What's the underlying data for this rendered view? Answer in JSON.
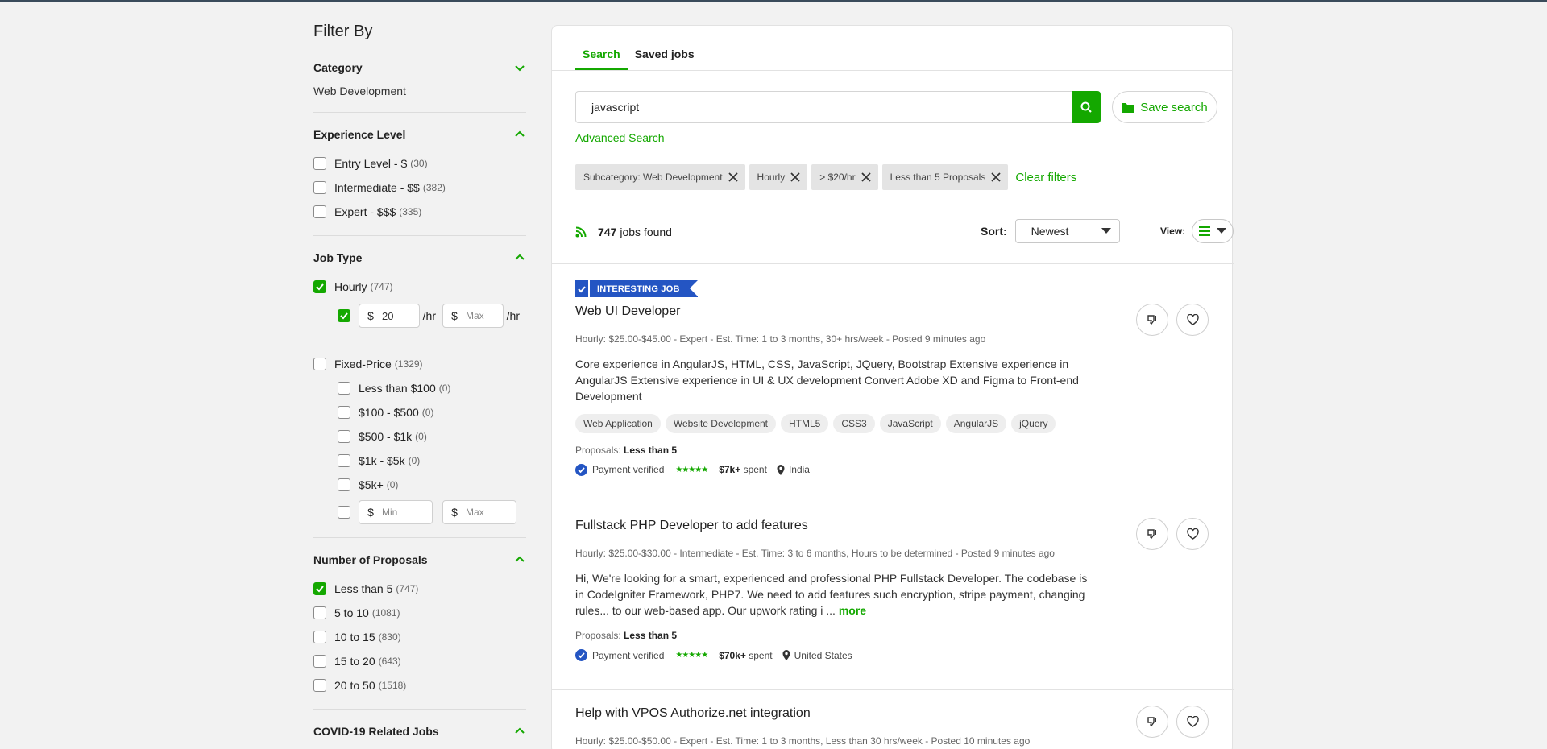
{
  "filters": {
    "title": "Filter By",
    "category": {
      "label": "Category",
      "value": "Web Development"
    },
    "experience": {
      "label": "Experience Level",
      "options": [
        {
          "label": "Entry Level - $",
          "count": "(30)",
          "checked": false
        },
        {
          "label": "Intermediate - $$",
          "count": "(382)",
          "checked": false
        },
        {
          "label": "Expert - $$$",
          "count": "(335)",
          "checked": false
        }
      ]
    },
    "job_type": {
      "label": "Job Type",
      "hourly": {
        "label": "Hourly",
        "count": "(747)",
        "checked": true
      },
      "rate": {
        "currency": "$",
        "min": "20",
        "max_placeholder": "Max",
        "unit": "/hr"
      },
      "fixed": {
        "label": "Fixed-Price",
        "count": "(1329)",
        "checked": false
      },
      "fixed_options": [
        {
          "label": "Less than $100",
          "count": "(0)"
        },
        {
          "label": "$100 - $500",
          "count": "(0)"
        },
        {
          "label": "$500 - $1k",
          "count": "(0)"
        },
        {
          "label": "$1k - $5k",
          "count": "(0)"
        },
        {
          "label": "$5k+",
          "count": "(0)"
        }
      ],
      "fixed_min_placeholder": "Min",
      "fixed_max_placeholder": "Max"
    },
    "proposals": {
      "label": "Number of Proposals",
      "options": [
        {
          "label": "Less than 5",
          "count": "(747)",
          "checked": true
        },
        {
          "label": "5 to 10",
          "count": "(1081)",
          "checked": false
        },
        {
          "label": "10 to 15",
          "count": "(830)",
          "checked": false
        },
        {
          "label": "15 to 20",
          "count": "(643)",
          "checked": false
        },
        {
          "label": "20 to 50",
          "count": "(1518)",
          "checked": false
        }
      ]
    },
    "covid": {
      "label": "COVID-19 Related Jobs"
    }
  },
  "tabs": {
    "search": "Search",
    "saved": "Saved jobs"
  },
  "search": {
    "query": "javascript",
    "save_label": "Save search",
    "advanced": "Advanced Search"
  },
  "chips": [
    "Subcategory: Web Development",
    "Hourly",
    "> $20/hr",
    "Less than 5 Proposals"
  ],
  "clear_filters": "Clear filters",
  "results": {
    "count": "747",
    "suffix": "jobs found"
  },
  "sort": {
    "label": "Sort:",
    "value": "Newest"
  },
  "view": {
    "label": "View:"
  },
  "jobs": [
    {
      "badge": "INTERESTING JOB",
      "title": "Web UI Developer",
      "meta": "Hourly: $25.00-$45.00 - Expert - Est. Time: 1 to 3 months, 30+ hrs/week - Posted 9 minutes ago",
      "desc": "Core experience in AngularJS, HTML, CSS, JavaScript, JQuery, Bootstrap Extensive experience in AngularJS Extensive experience in UI & UX development Convert Adobe XD and Figma to Front-end Development",
      "skills": [
        "Web Application",
        "Website Development",
        "HTML5",
        "CSS3",
        "JavaScript",
        "AngularJS",
        "jQuery"
      ],
      "proposals_label": "Proposals:",
      "proposals": "Less than 5",
      "payment": "Payment verified",
      "spent": "$7k+",
      "spent_suffix": "spent",
      "location": "India"
    },
    {
      "title": "Fullstack PHP Developer to add features",
      "meta": "Hourly: $25.00-$30.00 - Intermediate - Est. Time: 3 to 6 months, Hours to be determined - Posted 9 minutes ago",
      "desc": "Hi, We're looking for a smart, experienced and professional PHP Fullstack Developer. The codebase is in CodeIgniter Framework, PHP7. We need to add features such encryption, stripe payment, changing rules... to our web-based app. Our upwork rating i ...",
      "more": "more",
      "proposals_label": "Proposals:",
      "proposals": "Less than 5",
      "payment": "Payment verified",
      "spent": "$70k+",
      "spent_suffix": "spent",
      "location": "United States"
    },
    {
      "title": "Help with VPOS Authorize.net integration",
      "meta": "Hourly: $25.00-$50.00 - Expert - Est. Time: 1 to 3 months, Less than 30 hrs/week - Posted 10 minutes ago"
    }
  ],
  "colors": {
    "accent": "#14a800",
    "badge": "#2455c3",
    "verified": "#2455c3"
  }
}
